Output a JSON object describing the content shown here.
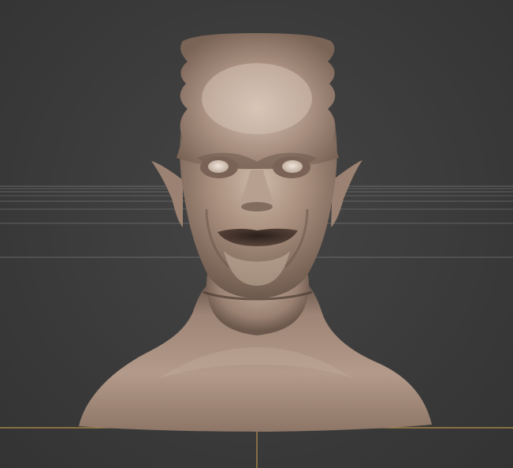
{
  "viewport": {
    "background": "#3a3a3a",
    "grid_color": "#8a8a8a",
    "axis_color": "#b8934a",
    "model_color": "#a48a7a"
  },
  "model": {
    "name_icon": "sculpt-head-bust-icon"
  }
}
